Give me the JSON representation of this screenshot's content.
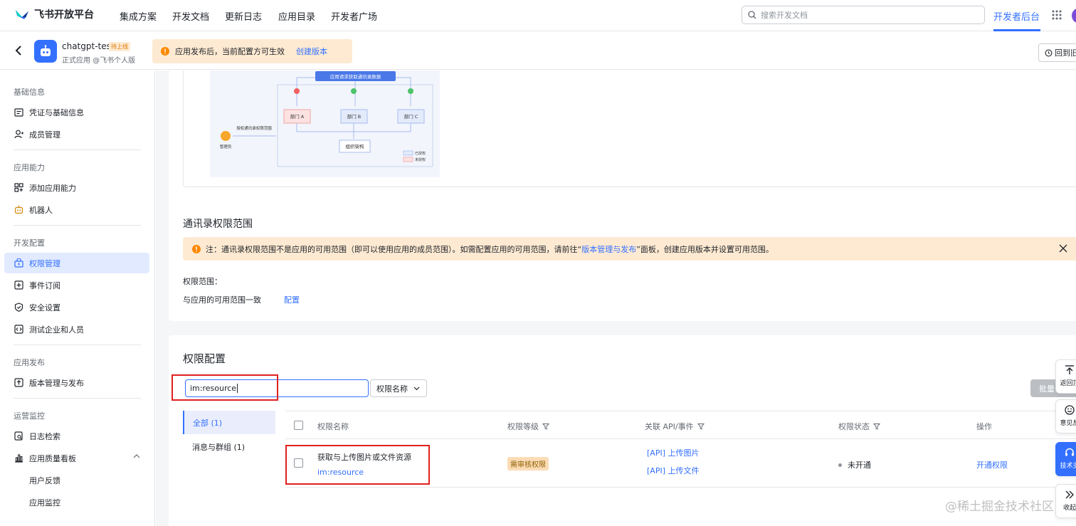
{
  "topnav": {
    "logo_text": "飞书开放平台",
    "items": [
      "集成方案",
      "开发文档",
      "更新日志",
      "应用目录",
      "开发者广场"
    ],
    "search_placeholder": "搜索开发文档",
    "dev_backend": "开发者后台"
  },
  "app": {
    "name": "chatgpt-test",
    "badge": "待上线",
    "subtitle": "正式应用 @飞书个人版",
    "publish_tip": "应用发布后，当前配置方可生效",
    "create_version": "创建版本",
    "rollback": "回到旧"
  },
  "sidebar": {
    "sections": [
      {
        "title": "基础信息",
        "items": [
          "凭证与基础信息",
          "成员管理"
        ]
      },
      {
        "title": "应用能力",
        "items": [
          "添加应用能力",
          "机器人"
        ]
      },
      {
        "title": "开发配置",
        "items": [
          "权限管理",
          "事件订阅",
          "安全设置",
          "测试企业和人员"
        ]
      },
      {
        "title": "应用发布",
        "items": [
          "版本管理与发布"
        ]
      },
      {
        "title": "运营监控",
        "items": [
          "日志检索",
          "应用质量看板"
        ],
        "subitems": [
          "用户反馈",
          "应用监控"
        ]
      }
    ],
    "active": "权限管理"
  },
  "diagram": {
    "top": "应用请求获取通讯录数据",
    "depts": [
      "部门 A",
      "部门 B",
      "部门 C"
    ],
    "org": "组织架构",
    "admin_action": "授权通讯录权限范围",
    "admin": "管理员",
    "legend_granted": "已授权",
    "legend_not": "未授权"
  },
  "contact_scope": {
    "title": "通讯录权限范围",
    "note_prefix": "注：通讯录权限范围不是应用的可用范围（即可以使用应用的成员范围）。如需配置应用的可用范围，请前往“",
    "note_link": "版本管理与发布",
    "note_suffix": "”面板，创建应用版本并设置可用范围。",
    "label": "权限范围：",
    "value": "与应用的可用范围一致",
    "configure": "配置"
  },
  "permissions": {
    "title": "权限配置",
    "search_value": "im:resource",
    "filter": "权限名称",
    "batch": "批量",
    "tabs": [
      {
        "label": "全部 (1)"
      },
      {
        "label": "消息与群组 (1)"
      }
    ],
    "columns": [
      "权限名称",
      "权限等级",
      "关联 API/事件",
      "权限状态",
      "操作"
    ],
    "rows": [
      {
        "name": "获取与上传图片或文件资源",
        "code": "im:resource",
        "level": "需审核权限",
        "apis": [
          "[API] 上传图片",
          "[API] 上传文件"
        ],
        "status": "未开通",
        "action": "开通权限"
      }
    ]
  },
  "float_tools": [
    "返回顶",
    "意见反",
    "技术支",
    "收起"
  ],
  "watermark": "@稀土掘金技术社区",
  "colors": {
    "accent": "#3370ff",
    "warning_bg": "#feead2",
    "highlight_red": "#e02020"
  }
}
